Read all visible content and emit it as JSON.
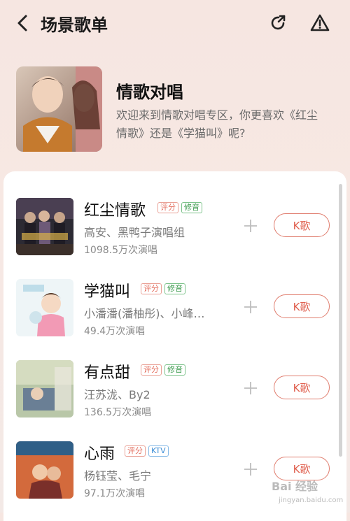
{
  "header": {
    "title": "场景歌单"
  },
  "hero": {
    "title": "情歌对唱",
    "description": "欢迎来到情歌对唱专区，你更喜欢《红尘情歌》还是《学猫叫》呢?"
  },
  "songs": [
    {
      "title": "红尘情歌",
      "tags": [
        "评分",
        "修音"
      ],
      "artist": "高安、黑鸭子演唱组",
      "plays": "1098.5万次演唱",
      "button": "K歌"
    },
    {
      "title": "学猫叫",
      "tags": [
        "评分",
        "修音"
      ],
      "artist": "小潘潘(潘柚彤)、小峰…",
      "plays": "49.4万次演唱",
      "button": "K歌"
    },
    {
      "title": "有点甜",
      "tags": [
        "评分",
        "修音"
      ],
      "artist": "汪苏泷、By2",
      "plays": "136.5万次演唱",
      "button": "K歌"
    },
    {
      "title": "心雨",
      "tags": [
        "评分",
        "KTV"
      ],
      "artist": "杨钰莹、毛宁",
      "plays": "97.1万次演唱",
      "button": "K歌"
    }
  ],
  "watermark": {
    "text": "Bai 经验",
    "sub": "jingyan.baidu.com"
  },
  "colors": {
    "accent": "#e0604f",
    "tag_score": "#e47060",
    "tag_fix": "#3a9a4c",
    "tag_ktv": "#3d8ed6"
  }
}
